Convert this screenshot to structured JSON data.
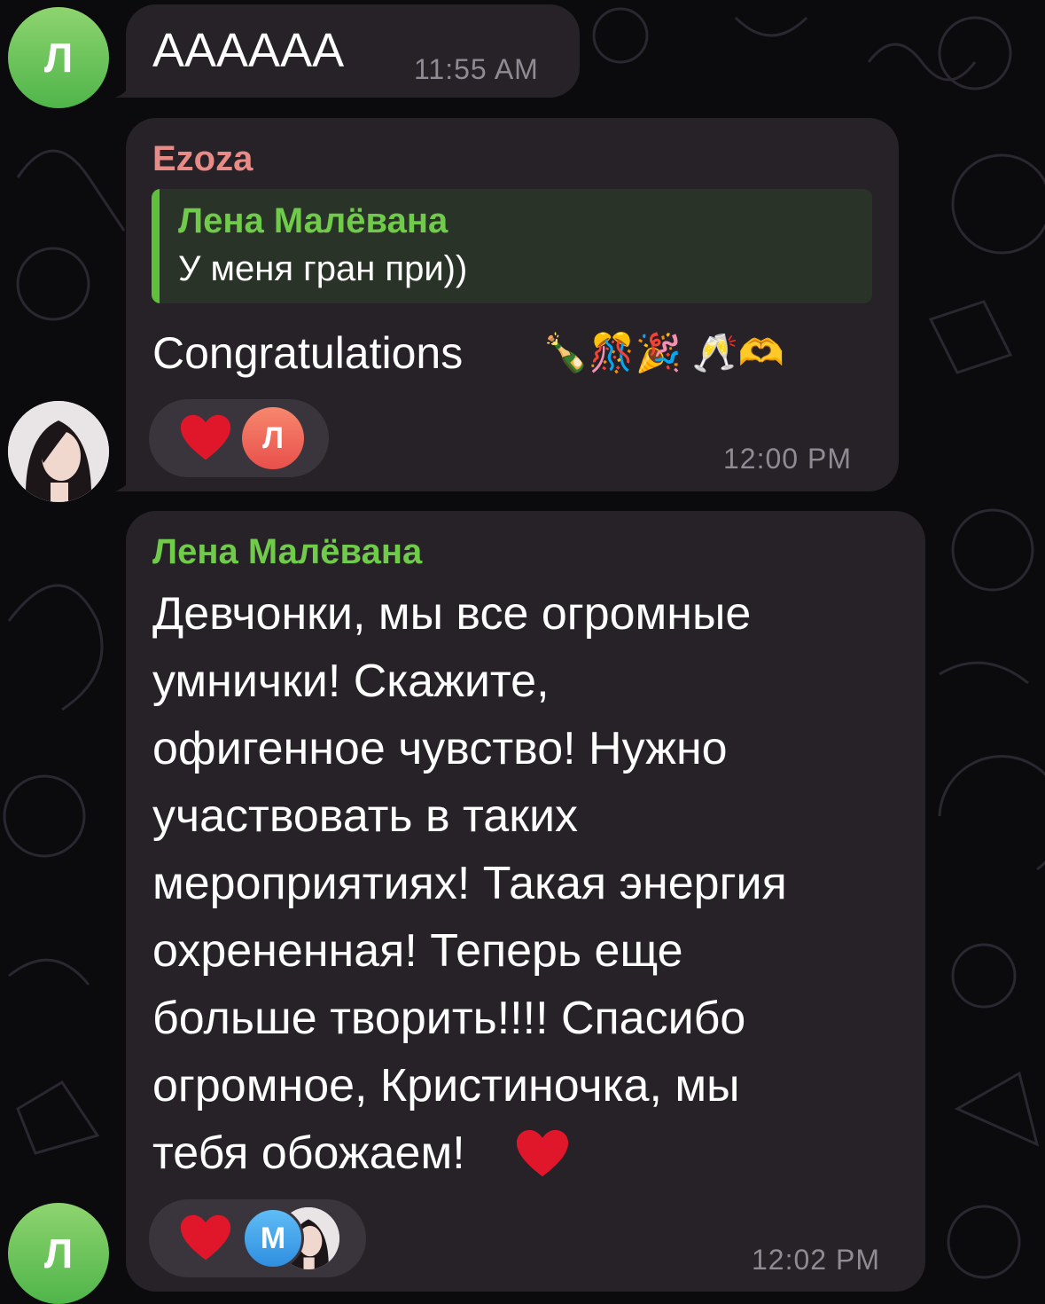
{
  "theme": {
    "bubble_color": "#262228",
    "green_name": "#6fcb49",
    "pink_name": "#e88a86",
    "time_color": "#8f8a93"
  },
  "messages": [
    {
      "avatar_initial": "Л",
      "text": "АААААА",
      "time": "11:55 AM"
    },
    {
      "sender": "Ezoza",
      "reply": {
        "name": "Лена Малёвана",
        "text": "У меня гран при))"
      },
      "text": "Congratulations",
      "emoji": "🍾🎊🎉 🥂🫶",
      "reactions": [
        {
          "emoji": "heart",
          "users": [
            "Л"
          ]
        }
      ],
      "time": "12:00 PM"
    },
    {
      "sender": "Лена Малёвана",
      "text": "Девчонки, мы все огромные\nумнички! Скажите,\nофигенное чувство! Нужно\nучаствовать в таких\nмероприятиях! Такая энергия\nохрененная! Теперь еще\nбольше творить!!!! Спасибо\nогромное, Кристиночка, мы\nтебя обожаем!",
      "reactions": [
        {
          "emoji": "heart",
          "users": [
            "М",
            "photo"
          ]
        }
      ],
      "time": "12:02 PM",
      "avatar_initial": "Л"
    }
  ]
}
